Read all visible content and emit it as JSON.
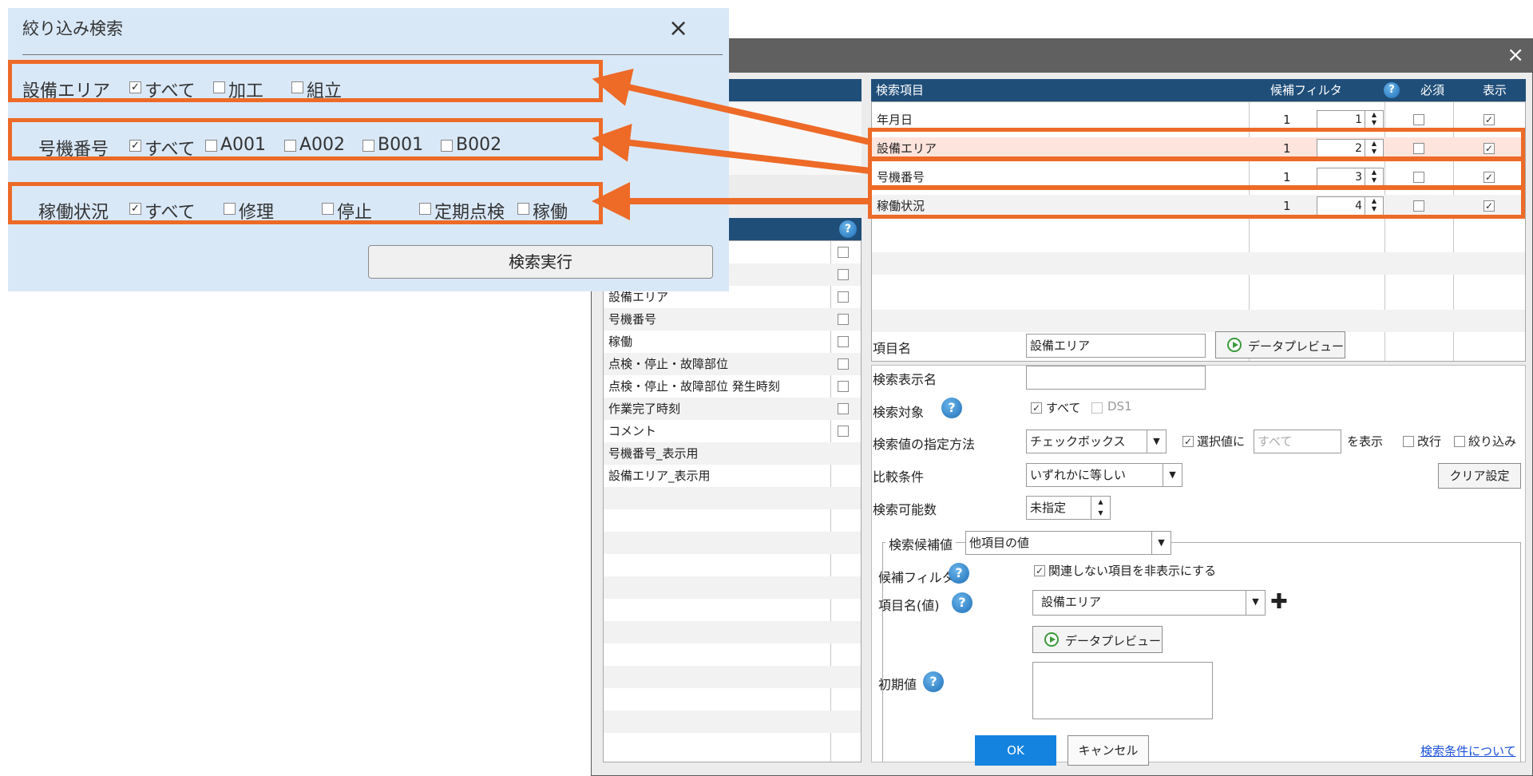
{
  "filter_panel": {
    "title": "絞り込み検索",
    "close": "×",
    "rows": [
      {
        "label": "設備エリア",
        "options": [
          {
            "text": "すべて",
            "checked": true
          },
          {
            "text": "加工",
            "checked": false
          },
          {
            "text": "組立",
            "checked": false
          }
        ]
      },
      {
        "label": "号機番号",
        "options": [
          {
            "text": "すべて",
            "checked": true
          },
          {
            "text": "A001",
            "checked": false
          },
          {
            "text": "A002",
            "checked": false
          },
          {
            "text": "B001",
            "checked": false
          },
          {
            "text": "B002",
            "checked": false
          }
        ]
      },
      {
        "label": "稼働状況",
        "options": [
          {
            "text": "すべて",
            "checked": true
          },
          {
            "text": "修理",
            "checked": false
          },
          {
            "text": "停止",
            "checked": false
          },
          {
            "text": "定期点検",
            "checked": false
          },
          {
            "text": "稼働",
            "checked": false
          }
        ]
      }
    ],
    "search_button": "検索実行"
  },
  "dialog": {
    "close": "×",
    "search_grid": {
      "headers": {
        "item": "検索項目",
        "filter": "候補フィルタ",
        "required": "必須",
        "display": "表示"
      },
      "rows": [
        {
          "item": "年月日",
          "filter": "1",
          "order": "1",
          "required": false,
          "display": true
        },
        {
          "item": "設備エリア",
          "filter": "1",
          "order": "2",
          "required": false,
          "display": true
        },
        {
          "item": "号機番号",
          "filter": "1",
          "order": "3",
          "required": false,
          "display": true
        },
        {
          "item": "稼働状況",
          "filter": "1",
          "order": "4",
          "required": false,
          "display": true
        }
      ]
    },
    "field_list": {
      "rows": [
        "設備エリア",
        "号機番号",
        "稼働",
        "点検・停止・故障部位",
        "点検・停止・故障部位 発生時刻",
        "作業完了時刻",
        "コメント",
        "号機番号_表示用",
        "設備エリア_表示用"
      ]
    },
    "form": {
      "item_name_label": "項目名",
      "item_name_value": "設備エリア",
      "data_preview": "データプレビュー",
      "display_name_label": "検索表示名",
      "display_name_value": "",
      "target_label": "検索対象",
      "target_all": "すべて",
      "target_ds": "DS1",
      "method_label": "検索値の指定方法",
      "method_value": "チェックボックス",
      "selected_value_label": "選択値に",
      "selected_value_placeholder": "すべて",
      "show_label": "を表示",
      "newline_label": "改行",
      "narrow_label": "絞り込み",
      "compare_label": "比較条件",
      "compare_value": "いずれかに等しい",
      "clear_button": "クリア設定",
      "count_label": "検索可能数",
      "count_value": "未指定",
      "candidate_group_label": "検索候補値",
      "candidate_source": "他項目の値",
      "candidate_filter_label": "候補フィルタ",
      "hide_unrelated": "関連しない項目を非表示にする",
      "item_name_value_label": "項目名(値)",
      "item_name_value_value": "設備エリア",
      "data_preview_2": "データプレビュー",
      "initial_value_label": "初期値"
    },
    "footer": {
      "ok": "OK",
      "cancel": "キャンセル",
      "help_link": "検索条件について"
    }
  },
  "colors": {
    "accent_orange": "#ed6a27",
    "header_blue": "#1f4e79",
    "ok_blue": "#1483e0",
    "panel_blue": "#d9e8f7"
  }
}
